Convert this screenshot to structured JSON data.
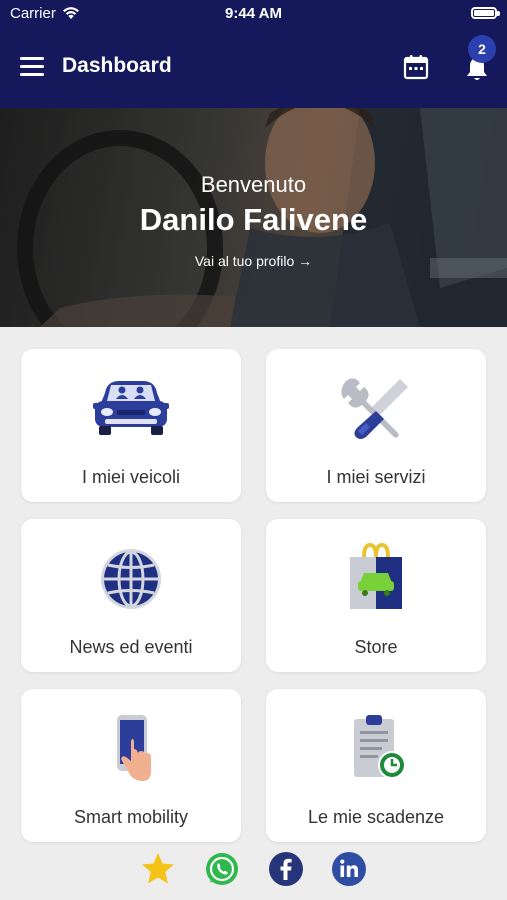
{
  "status_bar": {
    "carrier": "Carrier",
    "time": "9:44 AM"
  },
  "nav": {
    "title": "Dashboard",
    "notification_count": "2"
  },
  "hero": {
    "greeting": "Benvenuto",
    "username": "Danilo Falivene",
    "profile_link": "Vai al tuo profilo →"
  },
  "tiles": [
    {
      "label": "I miei veicoli",
      "icon": "car-icon"
    },
    {
      "label": "I miei servizi",
      "icon": "tools-icon"
    },
    {
      "label": "News ed eventi",
      "icon": "globe-icon"
    },
    {
      "label": "Store",
      "icon": "shopping-bag-icon"
    },
    {
      "label": "Smart mobility",
      "icon": "smartphone-touch-icon"
    },
    {
      "label": "Le mie scadenze",
      "icon": "clipboard-clock-icon"
    }
  ],
  "footer": {
    "icons": [
      "star-icon",
      "whatsapp-icon",
      "facebook-icon",
      "linkedin-icon"
    ]
  },
  "colors": {
    "brand_navy": "#15185b",
    "badge_blue": "#2b3fae",
    "background": "#ededed"
  }
}
